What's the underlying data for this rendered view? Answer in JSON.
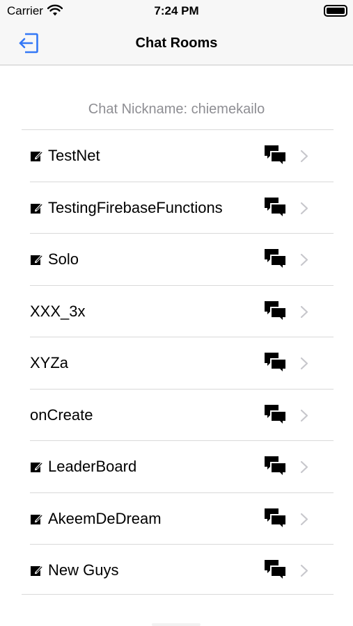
{
  "status": {
    "carrier": "Carrier",
    "time": "7:24 PM"
  },
  "nav": {
    "title": "Chat Rooms",
    "back_icon": "exit-icon"
  },
  "nickname_label": "Chat Nickname: chiemekailo",
  "colors": {
    "accent": "#3478f6",
    "secondary_text": "#8e8e93",
    "separator": "#d9d9d9",
    "chevron": "#c7c7cc"
  },
  "rooms": [
    {
      "name": "TestNet",
      "editable": true
    },
    {
      "name": "TestingFirebaseFunctions",
      "editable": true
    },
    {
      "name": "Solo",
      "editable": true
    },
    {
      "name": "XXX_3x",
      "editable": false
    },
    {
      "name": "XYZa",
      "editable": false
    },
    {
      "name": "onCreate",
      "editable": false
    },
    {
      "name": "LeaderBoard",
      "editable": true
    },
    {
      "name": "AkeemDeDream",
      "editable": true
    },
    {
      "name": "New Guys",
      "editable": true
    }
  ]
}
